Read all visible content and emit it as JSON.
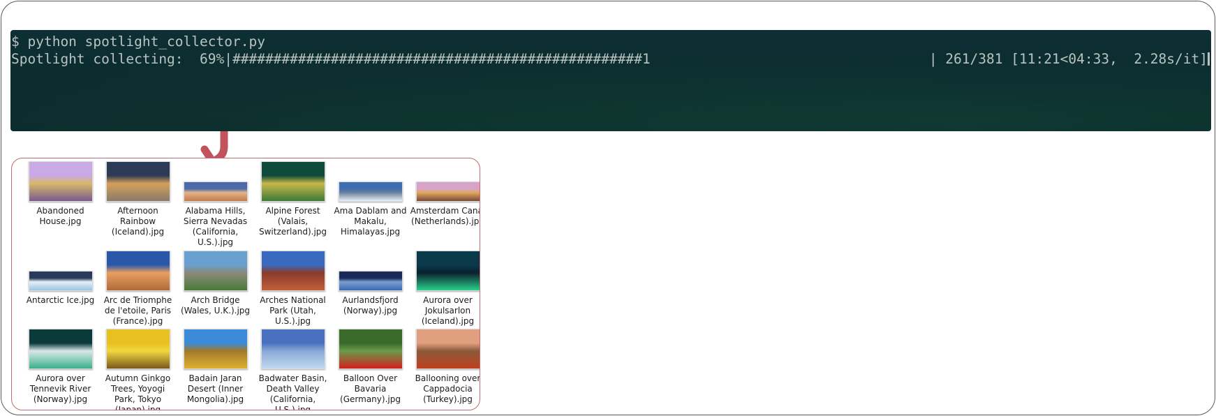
{
  "terminal": {
    "command": "$ python spotlight_collector.py",
    "progress_prefix": "Spotlight collecting:  69%|",
    "progress_bar": "##################################################1",
    "progress_stats": "| 261/381 [11:21<04:33,  2.28s/it]",
    "progress_percent": 69,
    "done": 261,
    "total": 381
  },
  "files": [
    {
      "label": "Abandoned House.jpg",
      "icon": "image-thumbnail",
      "colors": [
        "#c9a9e6",
        "#7a5a8f",
        "#d8b86a"
      ]
    },
    {
      "label": "Afternoon Rainbow (Iceland).jpg",
      "icon": "image-thumbnail",
      "colors": [
        "#2d3a55",
        "#8a7a6a",
        "#d4a05a"
      ]
    },
    {
      "label": "Alabama Hills, Sierra Nevadas (California, U.S.).jpg",
      "icon": "image-thumbnail",
      "colors": [
        "#4b6aa8",
        "#c47a4a",
        "#e3b48a"
      ]
    },
    {
      "label": "Alpine Forest (Valais, Switzerland).jpg",
      "icon": "image-thumbnail",
      "colors": [
        "#0f4a3a",
        "#3d7a3a",
        "#c9b84a"
      ]
    },
    {
      "label": "Ama Dablam and Makalu, Himalayas.jpg",
      "icon": "image-thumbnail",
      "colors": [
        "#3f6fb0",
        "#e8eef6",
        "#6a7f9a"
      ]
    },
    {
      "label": "Amsterdam Canal (Netherlands).jpg",
      "icon": "image-thumbnail",
      "colors": [
        "#d7a4c9",
        "#7a4a3a",
        "#e0a85a"
      ]
    },
    {
      "label": "Antarctic Ice.jpg",
      "icon": "image-thumbnail",
      "colors": [
        "#2a3a5a",
        "#9ac4e0",
        "#e6f0f8"
      ]
    },
    {
      "label": "Arc de Triomphe de l'etoile, Paris (France).jpg",
      "icon": "image-thumbnail",
      "colors": [
        "#2a58a8",
        "#b06a3a",
        "#e8a060"
      ]
    },
    {
      "label": "Arch Bridge (Wales, U.K.).jpg",
      "icon": "image-thumbnail",
      "colors": [
        "#6aa0d0",
        "#4a7a3a",
        "#8a8a7a"
      ]
    },
    {
      "label": "Arches National Park (Utah, U.S.).jpg",
      "icon": "image-thumbnail",
      "colors": [
        "#3a6ac0",
        "#c0603a",
        "#8a3a2a"
      ]
    },
    {
      "label": "Aurlandsfjord (Norway).jpg",
      "icon": "image-thumbnail",
      "colors": [
        "#1a2a5a",
        "#3a6ab0",
        "#7aa0d0"
      ]
    },
    {
      "label": "Aurora over Jokulsarlon (Iceland).jpg",
      "icon": "image-thumbnail",
      "colors": [
        "#0a3a4a",
        "#2ad08a",
        "#0a2030"
      ]
    },
    {
      "label": "Aurora over Tennevik River (Norway).jpg",
      "icon": "image-thumbnail",
      "colors": [
        "#0a3a3a",
        "#3ab08a",
        "#d8e8e8"
      ]
    },
    {
      "label": "Autumn Ginkgo Trees, Yoyogi Park, Tokyo (Japan).jpg",
      "icon": "image-thumbnail",
      "colors": [
        "#e8c020",
        "#7a5a1a",
        "#f0d840"
      ]
    },
    {
      "label": "Badain Jaran Desert (Inner Mongolia).jpg",
      "icon": "image-thumbnail",
      "colors": [
        "#3a8ad8",
        "#e0b030",
        "#a07a2a"
      ]
    },
    {
      "label": "Badwater Basin, Death Valley (California, U.S.).jpg",
      "icon": "image-thumbnail",
      "colors": [
        "#4a70c0",
        "#c0d8f0",
        "#8aa8d8"
      ]
    },
    {
      "label": "Balloon Over Bavaria (Germany).jpg",
      "icon": "image-thumbnail",
      "colors": [
        "#3a6a2a",
        "#d02020",
        "#6a9a4a"
      ]
    },
    {
      "label": "Ballooning over Cappadocia (Turkey).jpg",
      "icon": "image-thumbnail",
      "colors": [
        "#e0a080",
        "#c04020",
        "#8a5a3a"
      ]
    }
  ]
}
